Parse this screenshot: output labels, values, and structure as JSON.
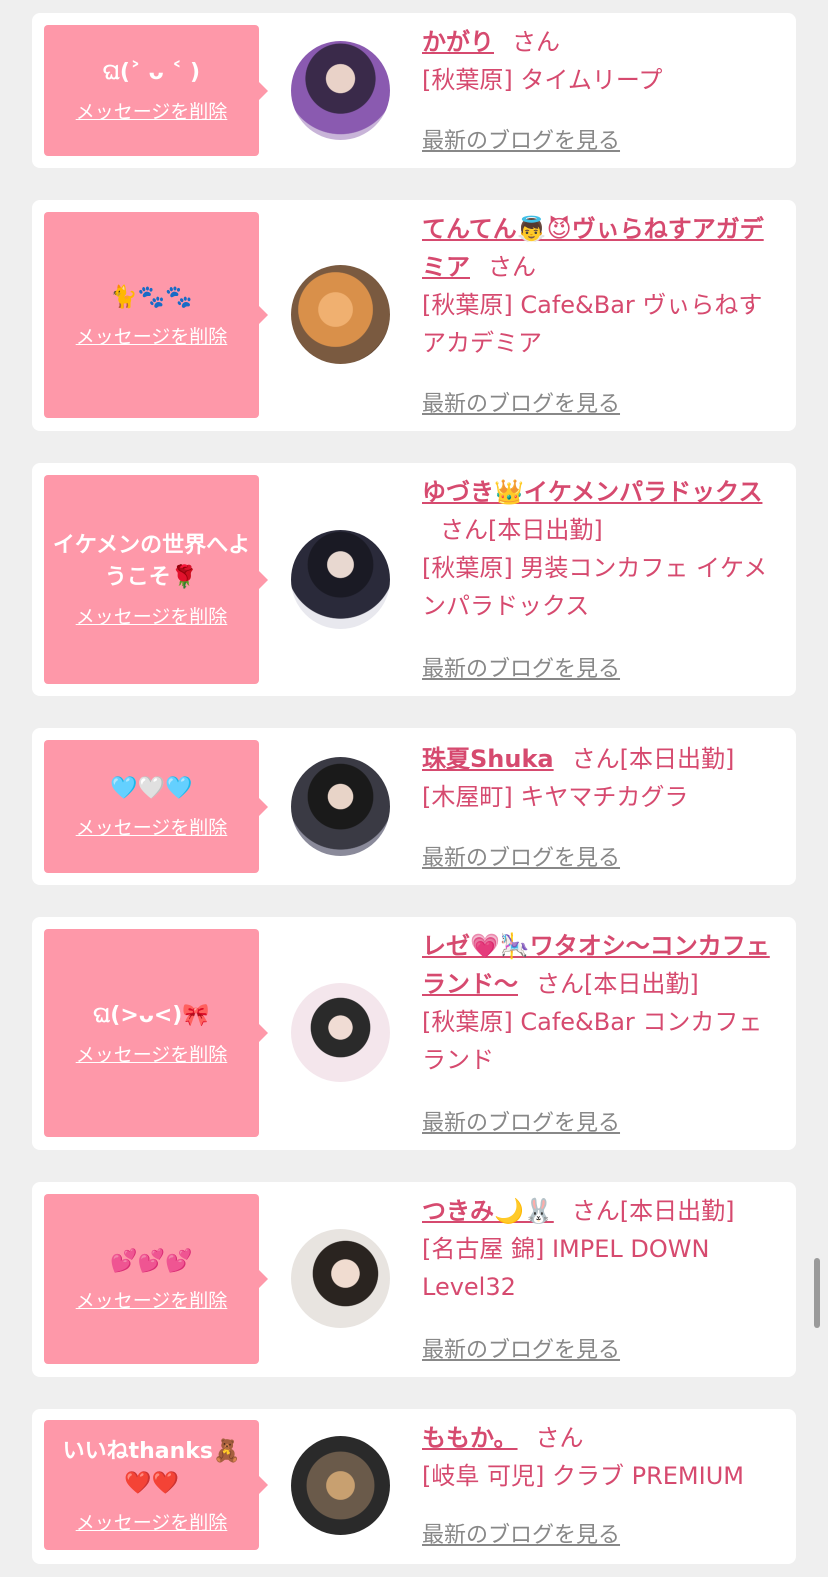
{
  "delete_label": "メッセージを削除",
  "san_label": "さん",
  "blog_label": "最新のブログを見る",
  "colors": {
    "bubble": "#fe98a9",
    "accent": "#d64a6f",
    "link_gray": "#888888"
  },
  "cards": [
    {
      "message": "ଘ(˃ ᴗ ˂ )",
      "name": "かがり",
      "badge": "",
      "shop": "[秋葉原] タイムリープ",
      "avatar_colors": [
        "#3a2a4a",
        "#8a5ab0"
      ]
    },
    {
      "message": "🐈🐾🐾",
      "name": "てんてん👼😈ヴぃらねすアガデミア",
      "badge": "",
      "shop": "[秋葉原] Cafe&Bar ヴぃらねすアカデミア",
      "avatar_colors": [
        "#5a4030",
        "#d9904a"
      ]
    },
    {
      "message": "イケメンの世界へようこそ🌹",
      "name": "ゆづき👑イケメンパラドックス",
      "badge": "[本日出勤]",
      "shop": "[秋葉原] 男装コンカフェ イケメンパラドックス",
      "avatar_colors": [
        "#1a1a24",
        "#e8e8ee"
      ]
    },
    {
      "message": "🩵🤍🩵",
      "name": "珠夏Shuka",
      "badge": "[本日出勤]",
      "shop": "[木屋町] キヤマチカグラ",
      "avatar_colors": [
        "#1a1a1a",
        "#8a8a9a"
      ]
    },
    {
      "message": "ଘ(>ᴗ<)🎀",
      "name": "レゼ💗🎠ワタオシ〜コンカフェランド〜",
      "badge": "[本日出勤]",
      "shop": "[秋葉原] Cafe&Bar コンカフェランド",
      "avatar_colors": [
        "#f4e6ec",
        "#2a2a2a"
      ]
    },
    {
      "message": "💕💕💕",
      "name": "つきみ🌙🐰",
      "badge": "[本日出勤]",
      "shop": "[名古屋 錦] IMPEL DOWN Level32",
      "avatar_colors": [
        "#e8e4e0",
        "#b03a2a"
      ]
    },
    {
      "message": "いいねthanks🧸❤️❤️",
      "name": "ももか。",
      "badge": "",
      "shop": "[岐阜 可児] クラブ PREMIUM",
      "avatar_colors": [
        "#2a2a2a",
        "#c8a070"
      ]
    }
  ]
}
